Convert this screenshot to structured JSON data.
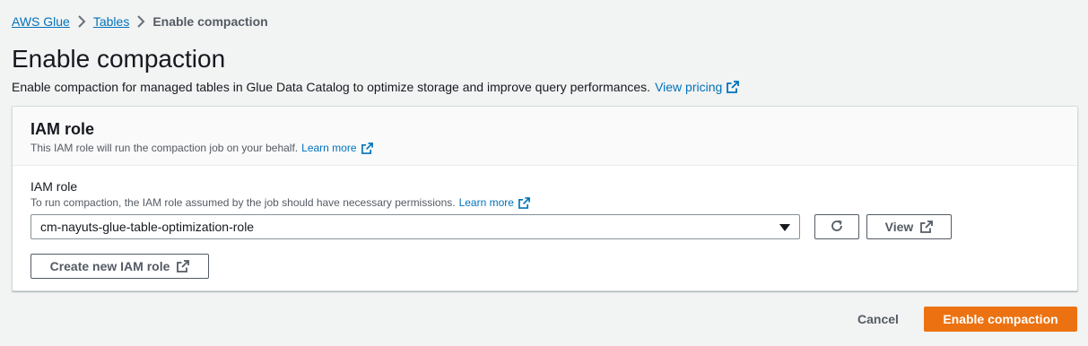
{
  "breadcrumb": {
    "items": [
      "AWS Glue",
      "Tables"
    ],
    "current": "Enable compaction",
    "separator_icon": "chevron-right-icon"
  },
  "page": {
    "title": "Enable compaction",
    "description": "Enable compaction for managed tables in Glue Data Catalog to optimize storage and improve query performances.",
    "pricing_link": "View pricing"
  },
  "iam_section": {
    "title": "IAM role",
    "description": "This IAM role will run the compaction job on your behalf.",
    "learn_more": "Learn more",
    "field": {
      "label": "IAM role",
      "description": "To run compaction, the IAM role assumed by the job should have necessary permissions.",
      "learn_more": "Learn more",
      "selected_value": "cm-nayuts-glue-table-optimization-role"
    },
    "view_button": "View",
    "create_button": "Create new IAM role"
  },
  "footer": {
    "cancel": "Cancel",
    "submit": "Enable compaction"
  },
  "colors": {
    "link": "#0073bb",
    "primary": "#ec7211",
    "background": "#f2f3f3"
  },
  "icons": [
    "chevron-right-icon",
    "external-link-icon",
    "refresh-icon",
    "caret-down-icon"
  ]
}
